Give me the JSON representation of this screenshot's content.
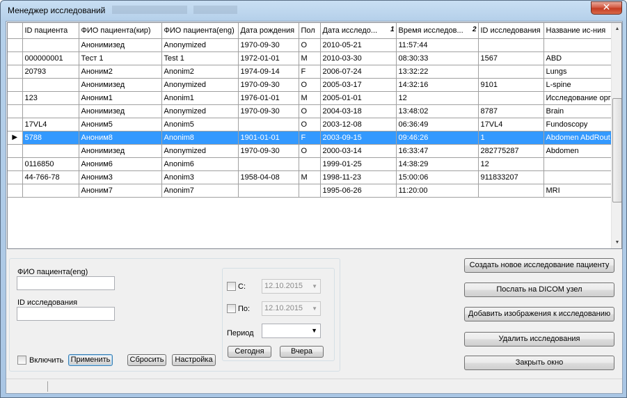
{
  "window": {
    "title": "Менеджер исследований"
  },
  "grid": {
    "columns": [
      {
        "label": "ID пациента",
        "width": 81
      },
      {
        "label": "ФИО пациента(кир)",
        "width": 119
      },
      {
        "label": "ФИО пациента(eng)",
        "width": 110
      },
      {
        "label": "Дата рождения",
        "width": 87
      },
      {
        "label": "Пол",
        "width": 31
      },
      {
        "label": "Дата исследо...",
        "width": 109,
        "sort": "1"
      },
      {
        "label": "Время исследов...",
        "width": 118,
        "sort": "2"
      },
      {
        "label": "ID исследования",
        "width": 94
      },
      {
        "label": "Название ис-ния",
        "width": 94
      }
    ],
    "rows": [
      [
        "",
        "Анонимизед",
        "Anonymized",
        "1970-09-30",
        "O",
        "2010-05-21",
        "11:57:44",
        "",
        ""
      ],
      [
        "000000001",
        "Тест 1",
        "Test 1",
        "1972-01-01",
        "M",
        "2010-03-30",
        "08:30:33",
        "1567",
        "ABD"
      ],
      [
        "20793",
        "Аноним2",
        "Anonim2",
        "1974-09-14",
        "F",
        "2006-07-24",
        "13:32:22",
        "",
        "Lungs"
      ],
      [
        "",
        "Анонимизед",
        "Anonymized",
        "1970-09-30",
        "O",
        "2005-03-17",
        "14:32:16",
        "9101",
        "L-spine"
      ],
      [
        "123",
        "Аноним1",
        "Anonim1",
        "1976-01-01",
        "M",
        "2005-01-01",
        "12",
        "",
        "Исследование орг"
      ],
      [
        "",
        "Анонимизед",
        "Anonymized",
        "1970-09-30",
        "O",
        "2004-03-18",
        "13:48:02",
        "8787",
        "Brain"
      ],
      [
        "17VL4",
        "Аноним5",
        "Anonim5",
        "",
        "O",
        "2003-12-08",
        "06:36:49",
        "17VL4",
        "Fundoscopy"
      ],
      [
        "5788",
        "Аноним8",
        "Anonim8",
        "1901-01-01",
        "F",
        "2003-09-15",
        "09:46:26",
        "1",
        "Abdomen AbdRout"
      ],
      [
        "",
        "Анонимизед",
        "Anonymized",
        "1970-09-30",
        "O",
        "2000-03-14",
        "16:33:47",
        "282775287",
        "Abdomen"
      ],
      [
        "0116850",
        "Аноним6",
        "Anonim6",
        "",
        "",
        "1999-01-25",
        "14:38:29",
        "12",
        ""
      ],
      [
        "44-766-78",
        "Аноним3",
        "Anonim3",
        "1958-04-08",
        "M",
        "1998-11-23",
        "15:00:06",
        "911833207",
        ""
      ],
      [
        "",
        "Аноним7",
        "Anonim7",
        "",
        "",
        "1995-06-26",
        "11:20:00",
        "",
        "MRI"
      ]
    ],
    "selected_row": 7,
    "row_indicator": "▶"
  },
  "filter": {
    "patient_name_label": "ФИО пациента(eng)",
    "patient_name_value": "",
    "study_id_label": "ID исследования",
    "study_id_value": "",
    "enable_label": "Включить",
    "apply_label": "Применить",
    "reset_label": "Сбросить",
    "settings_label": "Настройка"
  },
  "dates": {
    "from_label": "С:",
    "from_value": "12.10.2015",
    "to_label": "По:",
    "to_value": "12.10.2015",
    "period_label": "Период",
    "period_value": "",
    "today_label": "Сегодня",
    "yesterday_label": "Вчера"
  },
  "actions": {
    "create_study": "Создать новое исследование пациенту",
    "send_dicom": "Послать на DICOM узел",
    "add_images": "Добавить изображения к исследованию",
    "delete_studies": "Удалить исследования",
    "close_window": "Закрыть окно"
  },
  "icons": {
    "close": "close-icon",
    "scroll_up": "scroll-up-icon",
    "scroll_down": "scroll-down-icon",
    "dropdown": "chevron-down-icon"
  }
}
